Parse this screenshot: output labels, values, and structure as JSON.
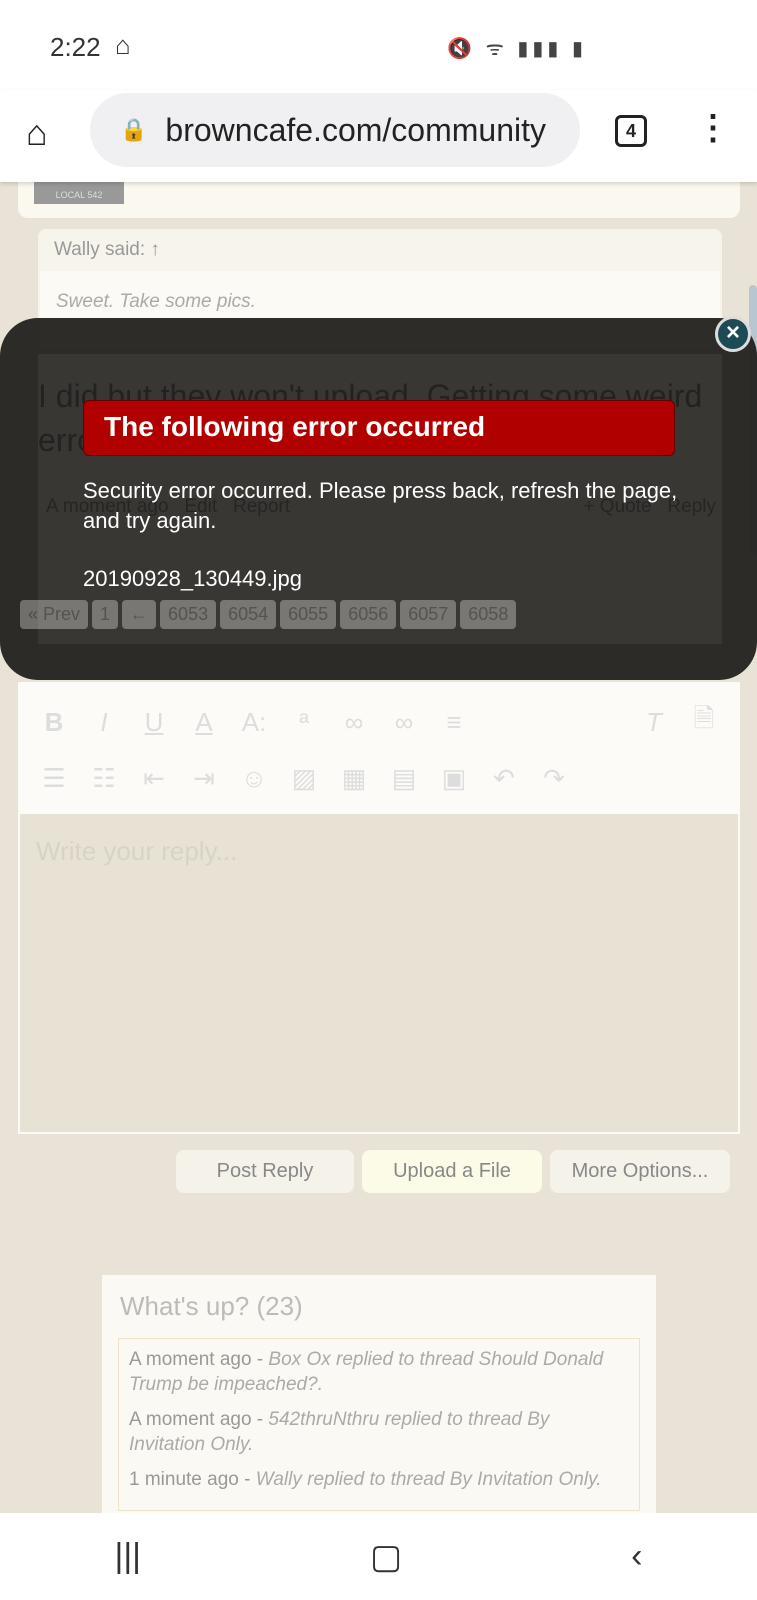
{
  "status": {
    "time": "2:22",
    "icons": "🔇 ᯤ ▮▮▮ ▮"
  },
  "browser": {
    "url": "browncafe.com/community",
    "tab_count": "4"
  },
  "avatar_text": "LOCAL 542",
  "quote": {
    "author": "Wally said: ↑",
    "text": "Sweet. Take some pics."
  },
  "post": {
    "text": "I did but they won't upload. Getting some weird error",
    "time": "A moment ago",
    "edit": "Edit",
    "report": "Report",
    "quote": "+ Quote",
    "reply": "Reply"
  },
  "pager": [
    "« Prev",
    "1",
    "←",
    "6053",
    "6054",
    "6055",
    "6056",
    "6057",
    "6058"
  ],
  "error": {
    "title": "The following error occurred",
    "message": "Security error occurred. Please press back, refresh the page, and try again.",
    "file": "20190928_130449.jpg"
  },
  "editor": {
    "placeholder": "Write your reply..."
  },
  "buttons": {
    "post": "Post Reply",
    "upload": "Upload a File",
    "more": "More Options..."
  },
  "whats_up": {
    "title": "What's up? (23)",
    "items": [
      {
        "time": "A moment ago",
        "text": "Box Ox replied to thread Should Donald Trump be impeached?."
      },
      {
        "time": "A moment ago",
        "text": "542thruNthru replied to thread By Invitation Only."
      },
      {
        "time": "1 minute ago",
        "text": "Wally replied to thread By Invitation Only."
      }
    ]
  }
}
